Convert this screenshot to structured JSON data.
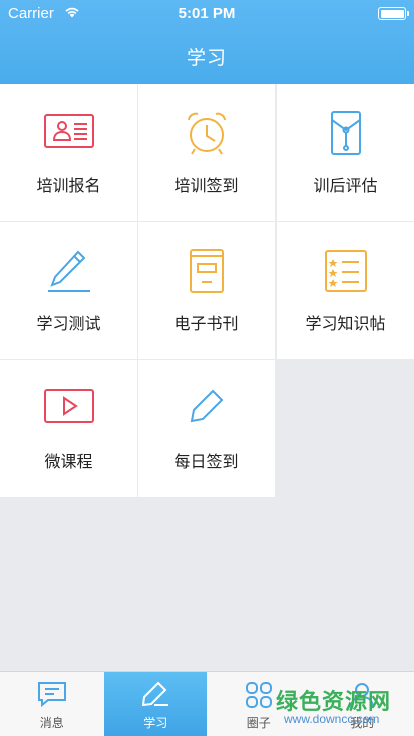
{
  "status_bar": {
    "carrier": "Carrier",
    "time": "5:01 PM"
  },
  "header": {
    "title": "学习"
  },
  "grid": {
    "items": [
      {
        "label": "培训报名",
        "icon": "id-card-icon"
      },
      {
        "label": "培训签到",
        "icon": "alarm-clock-icon"
      },
      {
        "label": "训后评估",
        "icon": "envelope-icon"
      },
      {
        "label": "学习测试",
        "icon": "pen-icon"
      },
      {
        "label": "电子书刊",
        "icon": "book-icon"
      },
      {
        "label": "学习知识帖",
        "icon": "list-icon"
      },
      {
        "label": "微课程",
        "icon": "video-play-icon"
      },
      {
        "label": "每日签到",
        "icon": "pencil-icon"
      }
    ]
  },
  "tabbar": {
    "tabs": [
      {
        "label": "消息",
        "icon": "message-icon",
        "active": false
      },
      {
        "label": "学习",
        "icon": "study-icon",
        "active": true
      },
      {
        "label": "圈子",
        "icon": "circles-icon",
        "active": false
      },
      {
        "label": "我的",
        "icon": "profile-icon",
        "active": false
      }
    ]
  },
  "watermark": {
    "text": "绿色资源网",
    "url": "www.downcc.com"
  },
  "colors": {
    "header": "#4aacec",
    "red": "#e8475c",
    "orange": "#f3b240",
    "blue": "#4aa6e6",
    "background": "#e8eaed"
  }
}
